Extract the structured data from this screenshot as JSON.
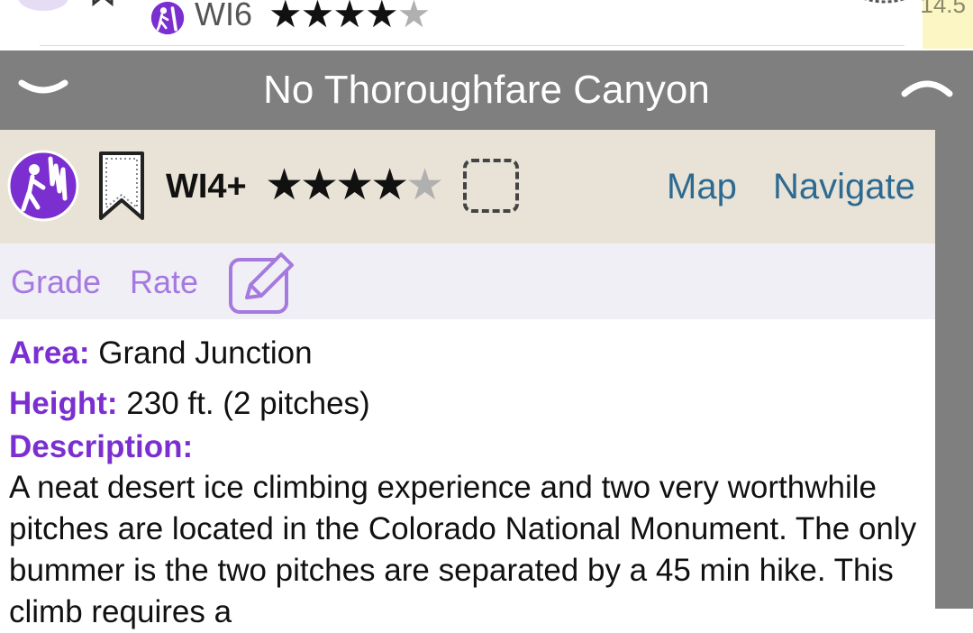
{
  "previous_item": {
    "grade": "WI6",
    "stars_filled": 4,
    "stars_total": 5,
    "distance": "14.5"
  },
  "header": {
    "title": "No Thoroughfare Canyon"
  },
  "toolbar": {
    "grade": "WI4+",
    "stars_filled": 4,
    "stars_total": 5,
    "map_label": "Map",
    "navigate_label": "Navigate"
  },
  "actions": {
    "grade_label": "Grade",
    "rate_label": "Rate"
  },
  "details": {
    "area_label": "Area:",
    "area_value": "Grand Junction",
    "height_label": "Height:",
    "height_value": "230 ft. (2 pitches)",
    "description_label": "Description:",
    "description_text": "A neat desert ice climbing experience and two very worthwhile pitches are located in the Colorado National Monument. The only bummer is the two pitches are separated by a 45 min hike. This climb requires a"
  },
  "colors": {
    "accent_purple": "#7b2fd0",
    "link_blue": "#2d6a91",
    "titlebar_gray": "#7f7f7f",
    "toolbar_beige": "#e8e3d6"
  },
  "icons": {
    "collapse": "chevron-down-icon",
    "expand": "chevron-up-icon",
    "climb_type": "ice-climber-icon",
    "bookmark": "bookmark-icon",
    "edit": "edit-pencil-icon"
  }
}
